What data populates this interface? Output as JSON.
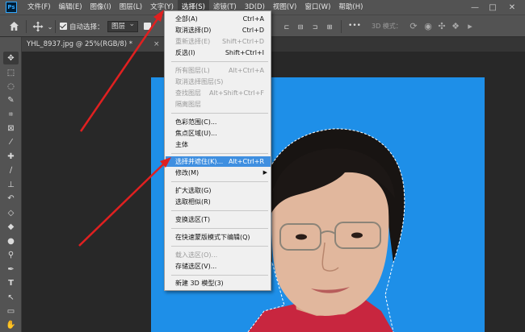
{
  "app": {
    "logo": "Ps"
  },
  "menubar": {
    "items": [
      "文件(F)",
      "编辑(E)",
      "图像(I)",
      "图层(L)",
      "文字(Y)",
      "选择(S)",
      "滤镜(T)",
      "3D(D)",
      "视图(V)",
      "窗口(W)",
      "帮助(H)"
    ],
    "active_index": 5,
    "window_controls": [
      "—",
      "□",
      "✕"
    ]
  },
  "options_bar": {
    "home_icon": "home-icon",
    "move_icon": "move-icon",
    "auto_select_label": "自动选择：",
    "auto_select_checked": true,
    "layer_value": "图层",
    "more_label": "•••",
    "mode_3d_label": "3D 模式："
  },
  "document_tab": {
    "title": "YHL_8937.jpg @ 25%(RGB/8) *",
    "close": "×"
  },
  "select_menu": {
    "items": [
      {
        "label": "全部(A)",
        "shortcut": "Ctrl+A",
        "enabled": true
      },
      {
        "label": "取消选择(D)",
        "shortcut": "Ctrl+D",
        "enabled": true
      },
      {
        "label": "重新选择(E)",
        "shortcut": "Shift+Ctrl+D",
        "enabled": false
      },
      {
        "label": "反选(I)",
        "shortcut": "Shift+Ctrl+I",
        "enabled": true
      },
      {
        "separator": true
      },
      {
        "label": "所有图层(L)",
        "shortcut": "Alt+Ctrl+A",
        "enabled": false
      },
      {
        "label": "取消选择图层(S)",
        "shortcut": "",
        "enabled": false
      },
      {
        "label": "查找图层",
        "shortcut": "Alt+Shift+Ctrl+F",
        "enabled": false
      },
      {
        "label": "隔离图层",
        "shortcut": "",
        "enabled": false
      },
      {
        "separator": true
      },
      {
        "label": "色彩范围(C)...",
        "shortcut": "",
        "enabled": true
      },
      {
        "label": "焦点区域(U)...",
        "shortcut": "",
        "enabled": true
      },
      {
        "label": "主体",
        "shortcut": "",
        "enabled": true
      },
      {
        "separator": true
      },
      {
        "label": "选择并遮住(K)...",
        "shortcut": "Alt+Ctrl+R",
        "enabled": true,
        "highlighted": true
      },
      {
        "label": "修改(M)",
        "shortcut": "",
        "enabled": true,
        "submenu": true
      },
      {
        "separator": true
      },
      {
        "label": "扩大选取(G)",
        "shortcut": "",
        "enabled": true
      },
      {
        "label": "选取相似(R)",
        "shortcut": "",
        "enabled": true
      },
      {
        "separator": true
      },
      {
        "label": "变换选区(T)",
        "shortcut": "",
        "enabled": true
      },
      {
        "separator": true
      },
      {
        "label": "在快速蒙版模式下编辑(Q)",
        "shortcut": "",
        "enabled": true
      },
      {
        "separator": true
      },
      {
        "label": "载入选区(O)...",
        "shortcut": "",
        "enabled": false
      },
      {
        "label": "存储选区(V)...",
        "shortcut": "",
        "enabled": true
      },
      {
        "separator": true
      },
      {
        "label": "新建 3D 模型(3)",
        "shortcut": "",
        "enabled": true
      }
    ]
  },
  "toolbar": {
    "tools": [
      "move-tool",
      "marquee-tool",
      "lasso-tool",
      "quick-select-tool",
      "crop-tool",
      "frame-tool",
      "eyedropper-tool",
      "healing-tool",
      "brush-tool",
      "clone-stamp-tool",
      "history-brush-tool",
      "eraser-tool",
      "paint-bucket-tool",
      "blur-tool",
      "dodge-tool",
      "pen-tool",
      "type-tool",
      "path-select-tool",
      "rectangle-tool",
      "hand-tool"
    ]
  },
  "colors": {
    "menubar": "#535353",
    "canvas": "#282828",
    "photo_background": "#1e8fe8",
    "highlight": "#3f8fe0",
    "annotation_arrow": "#e02020"
  }
}
